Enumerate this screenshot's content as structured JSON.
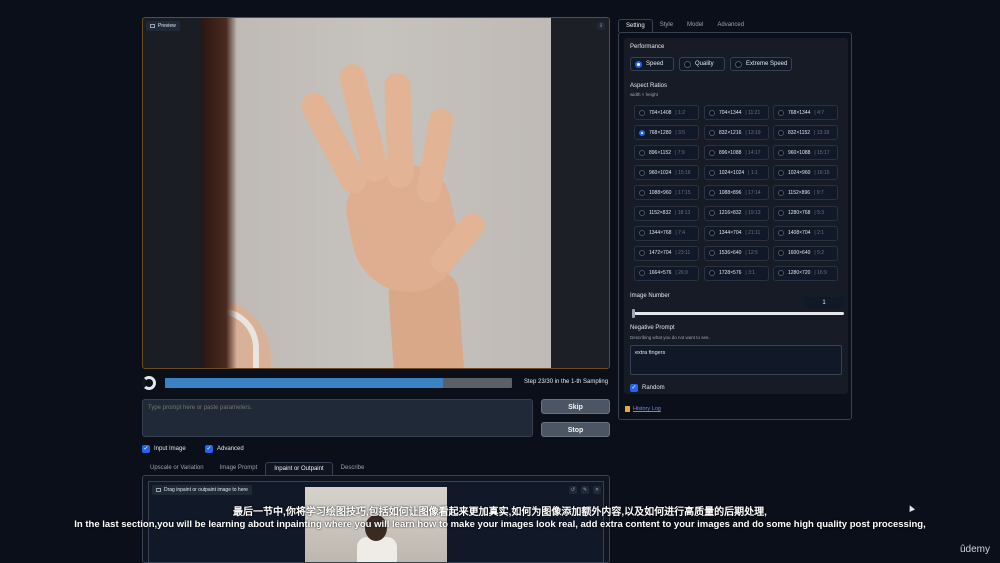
{
  "preview": {
    "label": "Preview"
  },
  "progress": {
    "step_text": "Step 23/30 in the 1-th Sampling",
    "fraction": 0.8
  },
  "prompt": {
    "placeholder": "Type prompt here or paste parameters."
  },
  "buttons": {
    "skip": "Skip",
    "stop": "Stop"
  },
  "checkboxes": [
    {
      "label": "Input Image",
      "checked": true
    },
    {
      "label": "Advanced",
      "checked": true
    }
  ],
  "bottom_tabs": [
    "Upscale or Variation",
    "Image Prompt",
    "Inpaint or Outpaint",
    "Describe"
  ],
  "bottom_tab_active": "Inpaint or Outpaint",
  "inpaint": {
    "drop_label": "Drag inpaint or outpaint image to here",
    "icons": [
      "undo-icon",
      "brush-icon",
      "close-icon"
    ]
  },
  "right_tabs": [
    "Setting",
    "Style",
    "Model",
    "Advanced"
  ],
  "right_tab_active": "Setting",
  "performance": {
    "title": "Performance",
    "options": [
      "Speed",
      "Quality",
      "Extreme Speed"
    ],
    "selected": "Speed"
  },
  "aspect_ratios": {
    "title": "Aspect Ratios",
    "subtitle": "width × height",
    "selected": "768×1280",
    "items": [
      {
        "size": "704×1408",
        "ratio": "| 1:2"
      },
      {
        "size": "704×1344",
        "ratio": "| 11:21"
      },
      {
        "size": "768×1344",
        "ratio": "| 4:7"
      },
      {
        "size": "768×1280",
        "ratio": "| 3:5"
      },
      {
        "size": "832×1216",
        "ratio": "| 13:19"
      },
      {
        "size": "832×1152",
        "ratio": "| 13:18"
      },
      {
        "size": "896×1152",
        "ratio": "| 7:9"
      },
      {
        "size": "896×1088",
        "ratio": "| 14:17"
      },
      {
        "size": "960×1088",
        "ratio": "| 15:17"
      },
      {
        "size": "960×1024",
        "ratio": "| 15:16"
      },
      {
        "size": "1024×1024",
        "ratio": "| 1:1"
      },
      {
        "size": "1024×960",
        "ratio": "| 16:15"
      },
      {
        "size": "1088×960",
        "ratio": "| 17:15"
      },
      {
        "size": "1088×896",
        "ratio": "| 17:14"
      },
      {
        "size": "1152×896",
        "ratio": "| 9:7"
      },
      {
        "size": "1152×832",
        "ratio": "| 18:13"
      },
      {
        "size": "1216×832",
        "ratio": "| 19:13"
      },
      {
        "size": "1280×768",
        "ratio": "| 5:3"
      },
      {
        "size": "1344×768",
        "ratio": "| 7:4"
      },
      {
        "size": "1344×704",
        "ratio": "| 21:11"
      },
      {
        "size": "1408×704",
        "ratio": "| 2:1"
      },
      {
        "size": "1472×704",
        "ratio": "| 23:11"
      },
      {
        "size": "1536×640",
        "ratio": "| 12:5"
      },
      {
        "size": "1600×640",
        "ratio": "| 5:2"
      },
      {
        "size": "1664×576",
        "ratio": "| 26:9"
      },
      {
        "size": "1728×576",
        "ratio": "| 3:1"
      },
      {
        "size": "1280×720",
        "ratio": "| 16:9"
      }
    ]
  },
  "image_number": {
    "title": "Image Number",
    "value": "1"
  },
  "negative_prompt": {
    "title": "Negative Prompt",
    "subtitle": "Describing what you do not want to see.",
    "value": "extra fingers"
  },
  "random": {
    "label": "Random",
    "checked": true
  },
  "history_log": "History Log",
  "subtitles": {
    "cn": "最后一节中,你将学习绘图技巧,包括如何让图像看起来更加真实,如何为图像添加额外内容,以及如何进行高质量的后期处理,",
    "en": "In the last section,you will be learning about inpainting where you will learn how to make your images look real, add extra content to your images and do some high quality post processing,"
  },
  "brand": "ûdemy"
}
